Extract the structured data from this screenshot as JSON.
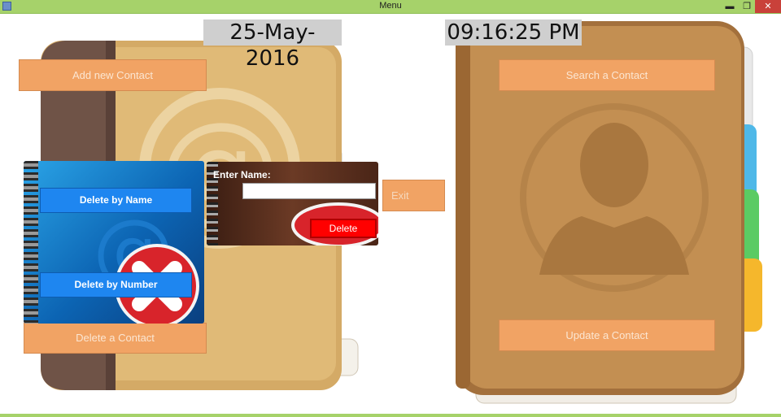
{
  "window": {
    "title": "Menu",
    "controls": {
      "minimize": "▬",
      "maximize": "❐",
      "close": "✕"
    }
  },
  "date": "25-May-2016",
  "time": "09:16:25 PM",
  "buttons": {
    "add_contact": "Add new Contact",
    "search_contact": "Search a Contact",
    "exit": "Exit",
    "delete_contact": "Delete a Contact",
    "update_contact": "Update a Contact"
  },
  "delete_menu": {
    "by_name": "Delete by Name",
    "by_number": "Delete by Number"
  },
  "delete_dialog": {
    "label": "Enter Name:",
    "value": "",
    "delete_button": "Delete"
  },
  "colors": {
    "titlebar": "#a6d26a",
    "orange_button": "#f1a364",
    "blue_button": "#1e86f0",
    "red_button": "#ff0000"
  },
  "icons": [
    "addressbook-icon",
    "contacts-book-icon",
    "at-symbol-icon",
    "person-silhouette-icon",
    "delete-x-icon"
  ]
}
